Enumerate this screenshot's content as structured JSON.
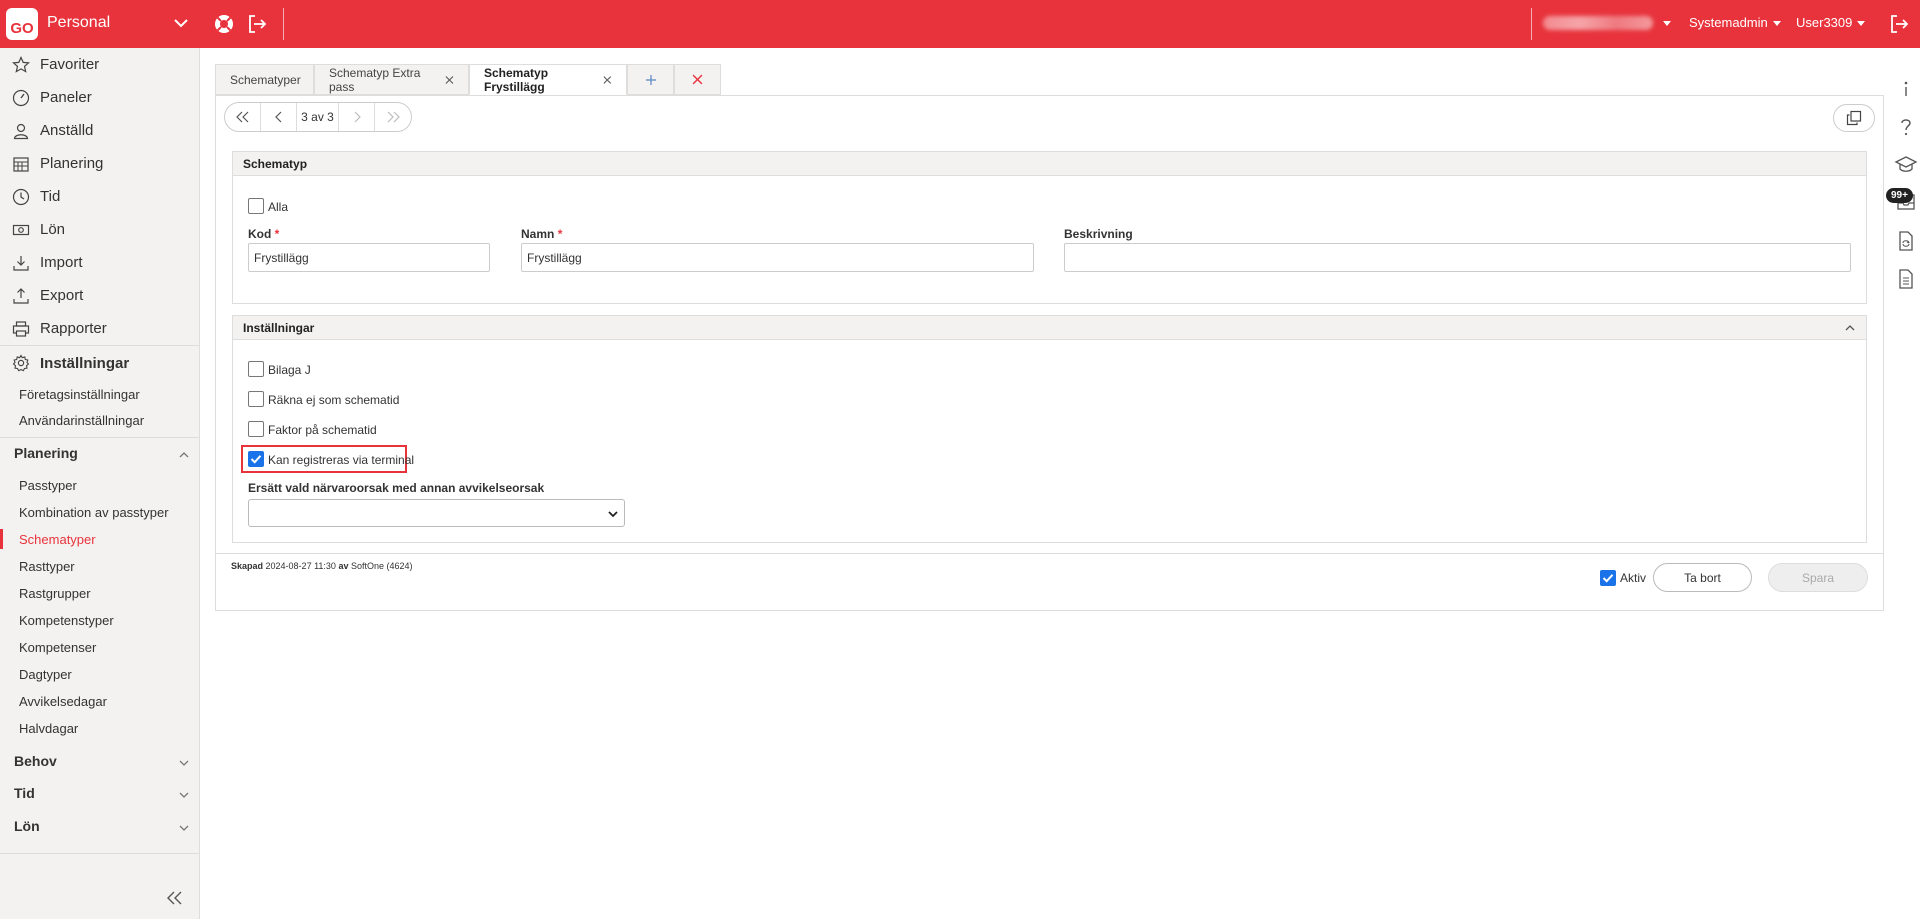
{
  "topbar": {
    "logo": "GO",
    "module": "Personal",
    "role_menu": "Systemadmin",
    "user_menu": "User3309"
  },
  "sidebar": {
    "main": [
      {
        "label": "Favoriter",
        "icon": "star-icon"
      },
      {
        "label": "Paneler",
        "icon": "dashboard-icon"
      },
      {
        "label": "Anställd",
        "icon": "person-icon"
      },
      {
        "label": "Planering",
        "icon": "calendar-icon"
      },
      {
        "label": "Tid",
        "icon": "clock-icon"
      },
      {
        "label": "Lön",
        "icon": "money-icon"
      },
      {
        "label": "Import",
        "icon": "import-icon"
      },
      {
        "label": "Export",
        "icon": "export-icon"
      },
      {
        "label": "Rapporter",
        "icon": "printer-icon"
      },
      {
        "label": "Inställningar",
        "icon": "gear-icon"
      }
    ],
    "settings_links": [
      "Företagsinställningar",
      "Användarinställningar"
    ],
    "groups": {
      "planering": {
        "title": "Planering",
        "items": [
          "Passtyper",
          "Kombination av passtyper",
          "Schematyper",
          "Rasttyper",
          "Rastgrupper",
          "Kompetenstyper",
          "Kompetenser",
          "Dagtyper",
          "Avvikelsedagar",
          "Halvdagar"
        ],
        "active": "Schematyper"
      },
      "behov": "Behov",
      "tid": "Tid",
      "lon": "Lön"
    }
  },
  "tabs": [
    {
      "label": "Schematyper",
      "closable": false
    },
    {
      "label": "Schematyp Extra pass",
      "closable": true
    },
    {
      "label": "Schematyp Frystillägg",
      "closable": true,
      "active": true
    }
  ],
  "pager": {
    "position": "3 av 3"
  },
  "schematyp": {
    "title": "Schematyp",
    "alla_label": "Alla",
    "alla_checked": false,
    "kod_label": "Kod",
    "kod_value": "Frystillägg",
    "namn_label": "Namn",
    "namn_value": "Frystillägg",
    "beskrivning_label": "Beskrivning",
    "beskrivning_value": "",
    "required_mark": "*"
  },
  "installningar": {
    "title": "Inställningar",
    "options": [
      {
        "label": "Bilaga J",
        "checked": false
      },
      {
        "label": "Räkna ej som schematid",
        "checked": false
      },
      {
        "label": "Faktor på schematid",
        "checked": false
      },
      {
        "label": "Kan registreras via terminal",
        "checked": true
      }
    ],
    "replace_label": "Ersätt vald närvaroorsak med annan avvikelseorsak",
    "replace_value": ""
  },
  "footer": {
    "created_label": "Skapad",
    "created_date": "2024-08-27 11:30",
    "by_label": "av",
    "created_by": "SoftOne (4624)",
    "aktiv_label": "Aktiv",
    "aktiv_checked": true,
    "delete_label": "Ta bort",
    "save_label": "Spara"
  },
  "rail": {
    "badge": "99+"
  },
  "colors": {
    "brand": "#e8333c",
    "checkbox": "#1a73e8"
  }
}
